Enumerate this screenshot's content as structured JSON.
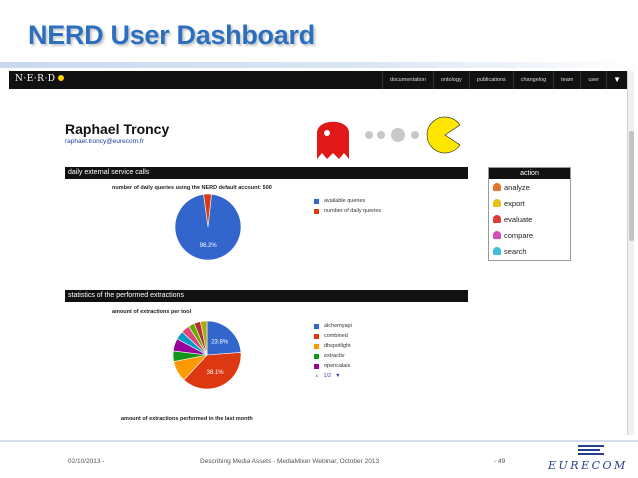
{
  "slide": {
    "title": "NERD User Dashboard",
    "footer_date": "02/10/2013 -",
    "footer_center": "Describing Media Assets - MediaMixer Webinar, October 2013",
    "footer_page": "- 49",
    "brand": "EURECOM"
  },
  "navbar": {
    "logo": "N·E·R·D",
    "items": [
      "documentation",
      "ontology",
      "publications",
      "changelog",
      "team",
      "user"
    ],
    "caret": "▼"
  },
  "user": {
    "name": "Raphael Troncy",
    "email": "raphael.troncy@eurecom.fr"
  },
  "sections": {
    "calls": "daily external service calls",
    "extractions": "statistics of the performed extractions"
  },
  "action_panel": {
    "title": "action",
    "items": [
      {
        "label": "analyze",
        "icon": "red-ghost-icon",
        "color": "#e8742a"
      },
      {
        "label": "export",
        "icon": "yellow-ghost-icon",
        "color": "#e6c21a"
      },
      {
        "label": "evaluate",
        "icon": "pink-ghost-icon",
        "color": "#e03a3a"
      },
      {
        "label": "compare",
        "icon": "magenta-ghost-icon",
        "color": "#d64fb5"
      },
      {
        "label": "search",
        "icon": "cyan-ghost-icon",
        "color": "#3fbfd8"
      }
    ]
  },
  "mascot": {
    "description_icons": [
      "ghost-icon",
      "dots-icon",
      "pacman-icon"
    ]
  },
  "chart_data": [
    {
      "type": "pie",
      "title": "number of daily queries using the NERD default account: 500",
      "labels": [
        "available queries",
        "number of daily queries"
      ],
      "values": [
        96.2,
        3.8
      ],
      "colors": [
        "#3366cc",
        "#dc3912"
      ],
      "data_labels": [
        "96.2%"
      ]
    },
    {
      "type": "pie",
      "title": "amount of extractions per tool",
      "labels": [
        "alchemyapi",
        "combined",
        "dbspotlight",
        "extractiv",
        "opencalais"
      ],
      "values": [
        23.8,
        38.1,
        10.0,
        5.0,
        6.0,
        4.0,
        4.0,
        3.0,
        3.0,
        3.1
      ],
      "colors": [
        "#3366cc",
        "#dc3912",
        "#ff9900",
        "#109618",
        "#990099",
        "#0099c6",
        "#dd4477",
        "#66aa00",
        "#b82e2e",
        "#aaaa11"
      ],
      "data_labels": [
        "23.8%",
        "38.1%"
      ],
      "pager": "1/2"
    }
  ],
  "next_chart_title": "amount of extractions performed in the last month"
}
